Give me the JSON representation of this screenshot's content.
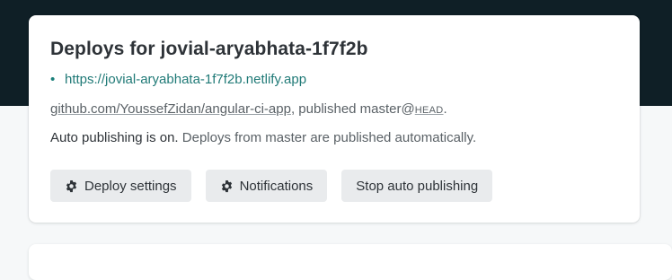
{
  "card": {
    "title": "Deploys for jovial-aryabhata-1f7f2b",
    "site_url": "https://jovial-aryabhata-1f7f2b.netlify.app",
    "bullet": "•",
    "repo_link": "github.com/YoussefZidan/angular-ci-app",
    "published_text": ", published master@",
    "head_ref": "HEAD",
    "period": ".",
    "auto_status": "Auto publishing is on.",
    "auto_description": " Deploys from master are published automatically."
  },
  "buttons": {
    "deploy_settings": {
      "label": "Deploy settings",
      "icon": "gear-icon"
    },
    "notifications": {
      "label": "Notifications",
      "icon": "gear-icon"
    },
    "stop_auto_publishing": {
      "label": "Stop auto publishing"
    }
  },
  "colors": {
    "hero_band": "#0f1f26",
    "link_teal": "#207a77",
    "button_bg": "#e9ebed",
    "page_bg": "#f6f8f9"
  }
}
